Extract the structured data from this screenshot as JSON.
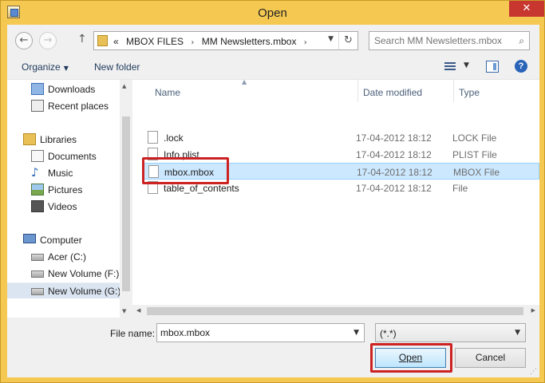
{
  "window": {
    "title": "Open",
    "close_glyph": "✕"
  },
  "nav": {
    "back_glyph": "←",
    "forward_glyph": "→",
    "up_glyph": "↑",
    "crumb_prefix": "«",
    "crumbs": [
      "MBOX FILES",
      "MM Newsletters.mbox"
    ],
    "crumb_separator": "›",
    "refresh_glyph": "↻",
    "search_placeholder": "Search MM Newsletters.mbox",
    "search_glyph": "⌕"
  },
  "toolbar": {
    "organize_label": "Organize",
    "new_folder_label": "New folder",
    "help_glyph": "?"
  },
  "sidebar": {
    "items": [
      {
        "label": "Downloads",
        "icon": "downloads-icon"
      },
      {
        "label": "Recent places",
        "icon": "recent-places-icon"
      },
      {
        "label": "Libraries",
        "icon": "libraries-icon"
      },
      {
        "label": "Documents",
        "icon": "documents-icon"
      },
      {
        "label": "Music",
        "icon": "music-icon"
      },
      {
        "label": "Pictures",
        "icon": "pictures-icon"
      },
      {
        "label": "Videos",
        "icon": "videos-icon"
      },
      {
        "label": "Computer",
        "icon": "computer-icon"
      },
      {
        "label": "Acer (C:)",
        "icon": "drive-icon"
      },
      {
        "label": "New Volume (F:)",
        "icon": "drive-icon"
      },
      {
        "label": "New Volume (G:)",
        "icon": "drive-icon",
        "selected": true
      }
    ]
  },
  "filelist": {
    "columns": [
      "Name",
      "Date modified",
      "Type"
    ],
    "rows": [
      {
        "name": ".lock",
        "date": "17-04-2012 18:12",
        "type": "LOCK File"
      },
      {
        "name": "Info.plist",
        "date": "17-04-2012 18:12",
        "type": "PLIST File"
      },
      {
        "name": "mbox.mbox",
        "date": "17-04-2012 18:12",
        "type": "MBOX File",
        "selected": true
      },
      {
        "name": "table_of_contents",
        "date": "17-04-2012 18:12",
        "type": "File"
      }
    ]
  },
  "bottom": {
    "file_name_label": "File name:",
    "file_name_value": "mbox.mbox",
    "filter_value": "(*.*)",
    "open_label": "Open",
    "cancel_label": "Cancel"
  },
  "colors": {
    "highlight": "#cc2222",
    "selection": "#cce8ff",
    "title_bar": "#f5c951"
  }
}
